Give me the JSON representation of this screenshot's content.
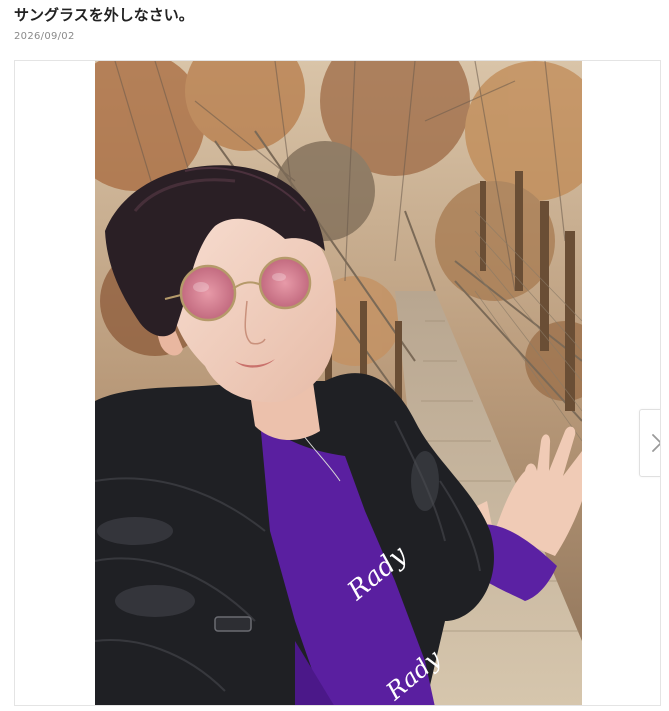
{
  "post": {
    "title": "サングラスを外しなさい。",
    "date": "2026/09/02"
  },
  "gallery": {
    "photo_alt": "Selfie of a person wearing pink round sunglasses, a black puffer jacket and a purple knit scarf on a wooden suspension bridge in an autumn forest",
    "scarf_text": "Rady",
    "next_icon": "chevron-right-icon",
    "colors": {
      "jacket": "#1e1f22",
      "sweater": "#5a1fa0",
      "bridge": "#c8b89a",
      "foliage": "#b7835a"
    }
  }
}
